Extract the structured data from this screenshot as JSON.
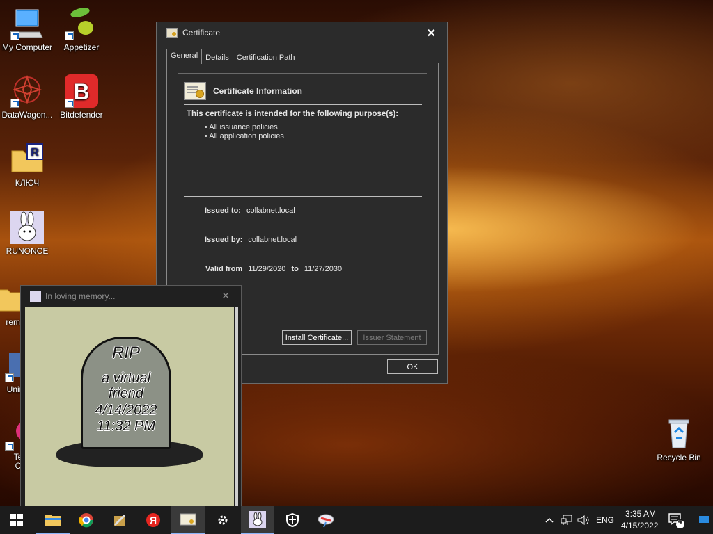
{
  "desktop": {
    "icons": [
      {
        "label": "My Computer",
        "icon": "computer-icon"
      },
      {
        "label": "Appetizer",
        "icon": "appetizer-icon"
      },
      {
        "label": "DataWagon...",
        "icon": "datawagon-icon"
      },
      {
        "label": "Bitdefender",
        "icon": "bitdefender-icon"
      },
      {
        "label": "КЛЮЧ",
        "icon": "folder-icon"
      },
      {
        "label": "RUNONCE",
        "icon": "bunny-icon"
      },
      {
        "label": "reme",
        "icon": "folder-icon"
      },
      {
        "label": "Unin",
        "icon": "uninstall-icon"
      },
      {
        "label": "Te\nC",
        "icon": "app-icon"
      },
      {
        "label": "Recycle Bin",
        "icon": "recycle-bin-icon"
      }
    ]
  },
  "certificate_dialog": {
    "title": "Certificate",
    "close": "✕",
    "tabs": [
      "General",
      "Details",
      "Certification Path"
    ],
    "active_tab": "General",
    "header": "Certificate Information",
    "purpose_text": "This certificate is intended for the following purpose(s):",
    "purposes": [
      "• All issuance policies",
      "• All application policies"
    ],
    "issued_to_label": "Issued to:",
    "issued_to": "collabnet.local",
    "issued_by_label": "Issued by:",
    "issued_by": "collabnet.local",
    "valid_from_label": "Valid from",
    "valid_from": "11/29/2020",
    "to_label": "to",
    "valid_to": "11/27/2030",
    "install_button": "Install Certificate...",
    "issuer_button": "Issuer Statement",
    "ok_button": "OK"
  },
  "memory_window": {
    "title": "In loving memory...",
    "close": "✕",
    "tombstone": [
      "RIP",
      "a virtual",
      "friend",
      "4/14/2022",
      "11:32 PM"
    ]
  },
  "taskbar": {
    "time": "3:35 AM",
    "date": "4/15/2022",
    "language": "ENG",
    "notification_count": "4"
  }
}
